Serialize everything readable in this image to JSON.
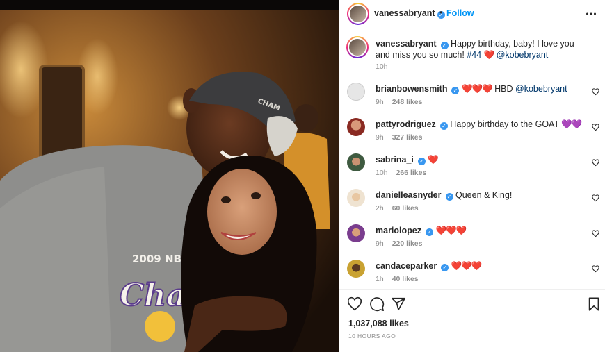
{
  "post": {
    "author": "vanessabryant",
    "follow_label": "Follow",
    "separator": "•",
    "caption": {
      "username": "vanessabryant",
      "text": "Happy birthday, baby! I love you and miss you so much! ",
      "hashtag": "#44",
      "hearts": "❤️",
      "mention": "@kobebryant",
      "time": "10h"
    },
    "photo_text": {
      "shirt_top": "2009 NBA",
      "shirt_script": "Cha",
      "cap_logo": "CHAM"
    }
  },
  "comments": [
    {
      "username": "brianbowensmith",
      "hearts": "❤️❤️❤️",
      "text": "HBD ",
      "mention": "@kobebryant",
      "time": "9h",
      "likes": "248 likes",
      "avatar_color": "#d9d9d9"
    },
    {
      "username": "pattyrodriguez",
      "hearts": "",
      "text": "Happy birthday to the GOAT ",
      "purple": "💜💜",
      "time": "9h",
      "likes": "327 likes",
      "avatar_color": "#b0413e"
    },
    {
      "username": "sabrina_i",
      "hearts": "❤️",
      "text": "",
      "time": "10h",
      "likes": "266 likes",
      "avatar_color": "#4a6b4e"
    },
    {
      "username": "danielleasnyder",
      "hearts": "",
      "text": "Queen & King!",
      "time": "2h",
      "likes": "60 likes",
      "avatar_color": "#e8d9c4"
    },
    {
      "username": "mariolopez",
      "hearts": "❤️❤️❤️",
      "text": "",
      "time": "9h",
      "likes": "220 likes",
      "avatar_color": "#8e4a9e"
    },
    {
      "username": "candaceparker",
      "hearts": "❤️❤️❤️",
      "text": "",
      "time": "1h",
      "likes": "40 likes",
      "avatar_color": "#b99a2a"
    }
  ],
  "footer": {
    "likes": "1,037,088 likes",
    "time_ago": "10 HOURS AGO"
  },
  "icons": {
    "like": "heart-icon",
    "comment": "comment-icon",
    "share": "share-icon",
    "save": "bookmark-icon",
    "more": "more-icon"
  },
  "colors": {
    "accent": "#0095f6",
    "verified": "#3897f0",
    "heart": "#ed4956"
  }
}
